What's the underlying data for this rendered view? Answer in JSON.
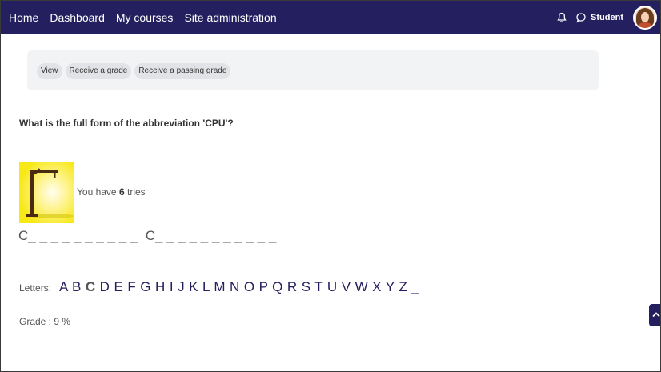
{
  "navbar": {
    "items": [
      "Home",
      "Dashboard",
      "My courses",
      "Site administration"
    ],
    "user_label": "Student",
    "icons": [
      "bell-icon",
      "chat-icon",
      "avatar"
    ],
    "background": "#241f5e"
  },
  "completion": {
    "pills": [
      "View",
      "Receive a grade",
      "Receive a passing grade"
    ]
  },
  "question": "What is the full form of the abbreviation 'CPU'?",
  "tries": {
    "prefix": "You have",
    "count": "6",
    "suffix": "tries"
  },
  "word_display": "C_ _ _ _ _ _ _ _ _ _  C_ _ _ _ _ _ _ _ _ _ _",
  "letters": {
    "label": "Letters:",
    "items": [
      "A",
      "B",
      "C",
      "D",
      "E",
      "F",
      "G",
      "H",
      "I",
      "J",
      "K",
      "L",
      "M",
      "N",
      "O",
      "P",
      "Q",
      "R",
      "S",
      "T",
      "U",
      "V",
      "W",
      "X",
      "Y",
      "Z",
      "_"
    ],
    "used": [
      "C"
    ],
    "color": "#241f5e"
  },
  "grade": "Grade : 9 %"
}
